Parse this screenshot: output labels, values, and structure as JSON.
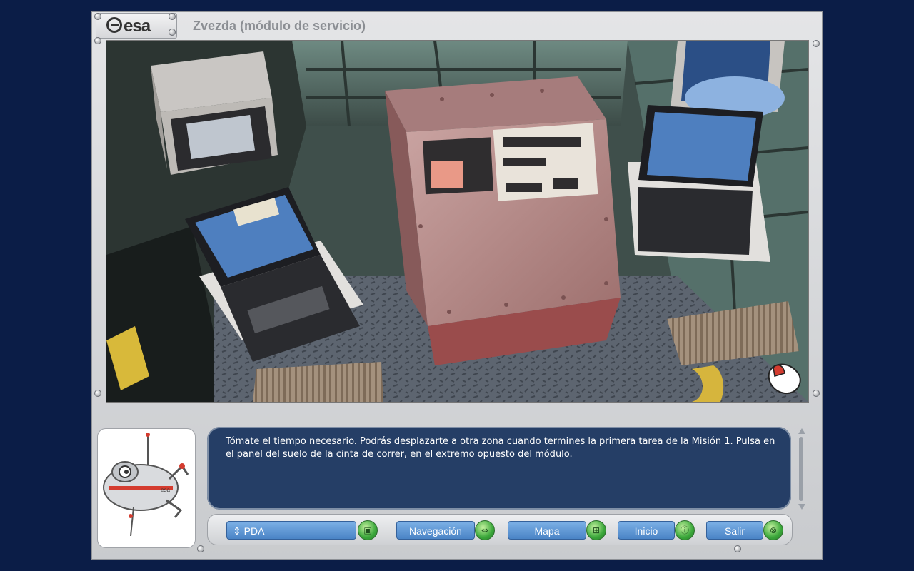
{
  "app": {
    "logo": "esa",
    "title": "Zvezda (módulo de servicio)"
  },
  "message": {
    "text": "Tómate el tiempo necesario. Podrás desplazarte a otra zona cuando termines la primera tarea de la Misión 1. Pulsa en el panel del suelo de la cinta de correr, en el extremo opuesto del módulo."
  },
  "nav": {
    "pda_arrows": "⇕",
    "pda_label": "PDA",
    "navegacion_label": "Navegación",
    "mapa_label": "Mapa",
    "inicio_label": "Inicio",
    "salir_label": "Salir"
  },
  "icons": {
    "pda": "pda-icon",
    "navegacion": "arrows-icon",
    "mapa": "map-icon",
    "inicio": "info-icon",
    "salir": "exit-icon",
    "cursor": "mouse-cursor-icon"
  },
  "colors": {
    "background": "#0b1d47",
    "frame": "#d4d6d9",
    "message_bg": "#253e66",
    "button_blue": "#5a93d4",
    "knob_green": "#3aa73a"
  }
}
